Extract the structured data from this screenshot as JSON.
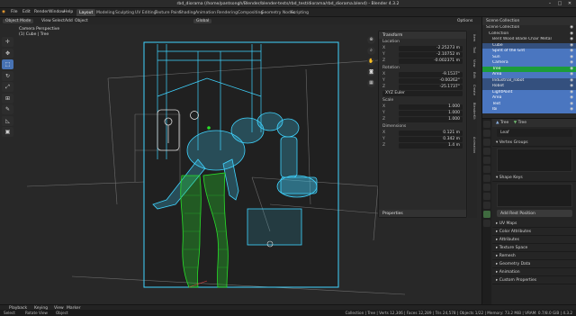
{
  "window": {
    "title": "rbd_diorama (/home/pantsongh/Blender/blender-tests/rbd_test/diorama/rbd_diorama.blend) - Blender 4.3.2",
    "controls": [
      "–",
      "□",
      "✕"
    ]
  },
  "menubar": {
    "menus": [
      "File",
      "Edit",
      "Render",
      "Window",
      "Help"
    ],
    "workspaces": [
      "Layout",
      "Modeling",
      "Sculpting",
      "UV Editing",
      "Texture Paint",
      "Shading",
      "Animation",
      "Rendering",
      "Compositing",
      "Geometry Nodes",
      "Scripting"
    ],
    "active_workspace": "Layout"
  },
  "viewport_header": {
    "mode": "Object Mode",
    "menus": [
      "View",
      "Select",
      "Add",
      "Object"
    ],
    "transform": "Global",
    "options": "Options",
    "overlay_text_1": "Camera Perspective",
    "overlay_text_2": "(1) Cube | Tree"
  },
  "toolbar": {
    "tools": [
      "cursor-icon",
      "move-icon",
      "select-box-icon",
      "rotate-icon",
      "scale-icon",
      "transform-icon",
      "annotate-icon",
      "measure-icon",
      "add-cube-icon"
    ],
    "active_index": 2
  },
  "n_panel": {
    "header": "Transform",
    "location_label": "Location",
    "location": {
      "X": "-2.25273 m",
      "Y": "-2.10752 m",
      "Z": "-0.002371 m"
    },
    "rotation_label": "Rotation",
    "rotation": {
      "X": "-9.1537°",
      "Y": "-0.00262°",
      "Z": "-25.1737°"
    },
    "rotation_mode": "XYZ Euler",
    "scale_label": "Scale",
    "scale": {
      "X": "1.000",
      "Y": "1.000",
      "Z": "1.000"
    },
    "dimensions_label": "Dimensions",
    "dimensions": {
      "X": "0.121 m",
      "Y": "0.342 m",
      "Z": "1.4 m"
    },
    "properties_label": "Properties",
    "tabs": [
      "Item",
      "Tool",
      "View",
      "Edit",
      "Create",
      "BlenderKit",
      "Animation"
    ]
  },
  "outliner": {
    "header": "Scene Collection",
    "rows": [
      {
        "label": "Scene Collection",
        "state": "normal"
      },
      {
        "label": "Collection",
        "state": "normal"
      },
      {
        "label": "Bent Wood Blade Chair Metal",
        "state": "normal"
      },
      {
        "label": "Cube",
        "state": "sel-dim"
      },
      {
        "label": "Spirit of the Grit",
        "state": "sel"
      },
      {
        "label": "Sun",
        "state": "sel"
      },
      {
        "label": "Camera",
        "state": "sel"
      },
      {
        "label": "Tree",
        "state": "active"
      },
      {
        "label": "Area",
        "state": "sel"
      },
      {
        "label": "Industrial_robot",
        "state": "sel-dim"
      },
      {
        "label": "Robot",
        "state": "sel-dim"
      },
      {
        "label": "LightPoint",
        "state": "sel"
      },
      {
        "label": "Area",
        "state": "sel"
      },
      {
        "label": "Text",
        "state": "sel"
      },
      {
        "label": "Ibi",
        "state": "sel"
      }
    ]
  },
  "properties": {
    "object": "Tree",
    "data_name": "Tree",
    "mesh_name": "Leaf",
    "sections": [
      "Vertex Groups",
      "Shape Keys",
      "UV Maps",
      "Color Attributes",
      "Attributes",
      "Texture Space",
      "Remesh",
      "Geometry Data",
      "Animation",
      "Custom Properties"
    ],
    "add_rest_position": "Add Rest Position"
  },
  "timeline": {
    "items": [
      "Playback",
      "Keying",
      "View",
      "Marker"
    ]
  },
  "statusbar": {
    "left": [
      "Select",
      "Rotate View",
      "Object"
    ],
    "right": "Collection | Tree | Verts 12,306 | Faces 12,289 | Tris 24,578 | Objects 1/22 | Memory: 73.2 MiB | VRAM: 0.7/8.0 GiB | 4.3.2"
  },
  "colors": {
    "wire_blue": "#3fd4ff",
    "wire_green": "#28e02a",
    "selection_blue": "#4a76c0",
    "active_green": "#1c9c3a",
    "camera_frame": "#262626"
  }
}
